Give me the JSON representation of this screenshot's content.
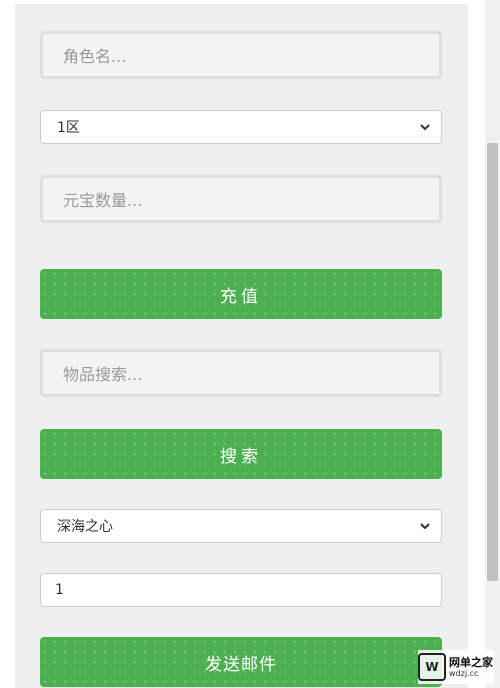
{
  "form": {
    "role_name_placeholder": "角色名...",
    "server_select_value": "1区",
    "ingot_amount_placeholder": "元宝数量...",
    "recharge_button_label": "充值",
    "item_search_placeholder": "物品搜索...",
    "search_button_label": "搜索",
    "item_select_value": "深海之心",
    "quantity_value": "1",
    "send_mail_button_label": "发送邮件"
  },
  "watermark": {
    "logo": "W",
    "name": "网单之家",
    "url": "wdzj.cc"
  },
  "colors": {
    "button_green": "#4caf50",
    "panel_bg": "#efefef"
  }
}
